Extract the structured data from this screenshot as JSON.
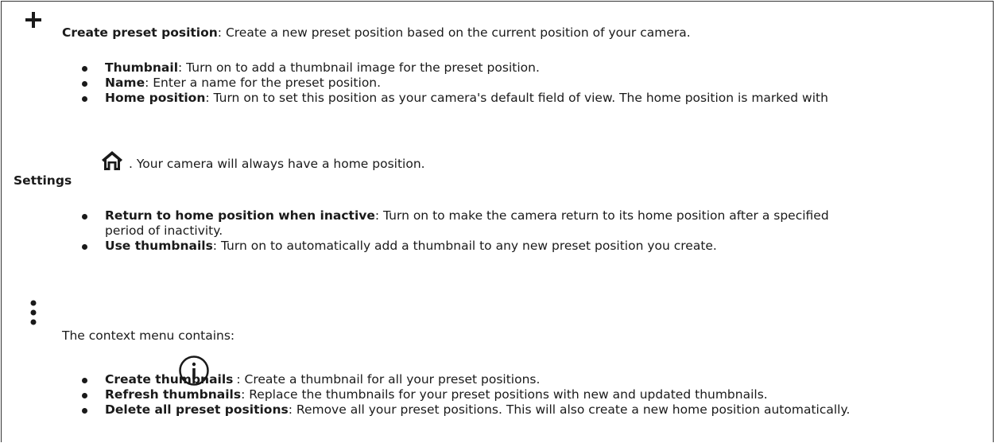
{
  "icons": {
    "plus": "plus-icon",
    "home": "home-icon",
    "context_menu": "more-vertical-icon",
    "info": "info-icon"
  },
  "create_preset": {
    "title": "Create preset position",
    "description": ": Create a new preset position based on the current position of your camera.",
    "items": [
      {
        "label": "Thumbnail",
        "text": ": Turn on to add a thumbnail image for the preset position."
      },
      {
        "label": "Name",
        "text": ": Enter a name for the preset position."
      },
      {
        "label": "Home position",
        "text": ": Turn on to set this position as your camera's default field of view. The home position is marked with"
      }
    ],
    "home_note": ". Your camera will always have a home position."
  },
  "settings": {
    "heading": "Settings",
    "items": [
      {
        "label": "Return to home position when inactive",
        "text": ": Turn on to make the camera return to its home position after a specified",
        "text_line2": "period of inactivity."
      },
      {
        "label": "Use thumbnails",
        "text": ": Turn on to automatically add a thumbnail to any new preset position you create."
      }
    ]
  },
  "context_menu": {
    "intro": "The context menu contains:",
    "items": [
      {
        "label": "Create thumbnails",
        "text": ": Create a thumbnail for all your preset positions."
      },
      {
        "label": "Refresh thumbnails",
        "text": ": Replace the thumbnails for your preset positions with new and updated thumbnails."
      },
      {
        "label": "Delete all preset positions",
        "text": ": Remove all your preset positions. This will also create a new home position automatically."
      }
    ]
  }
}
